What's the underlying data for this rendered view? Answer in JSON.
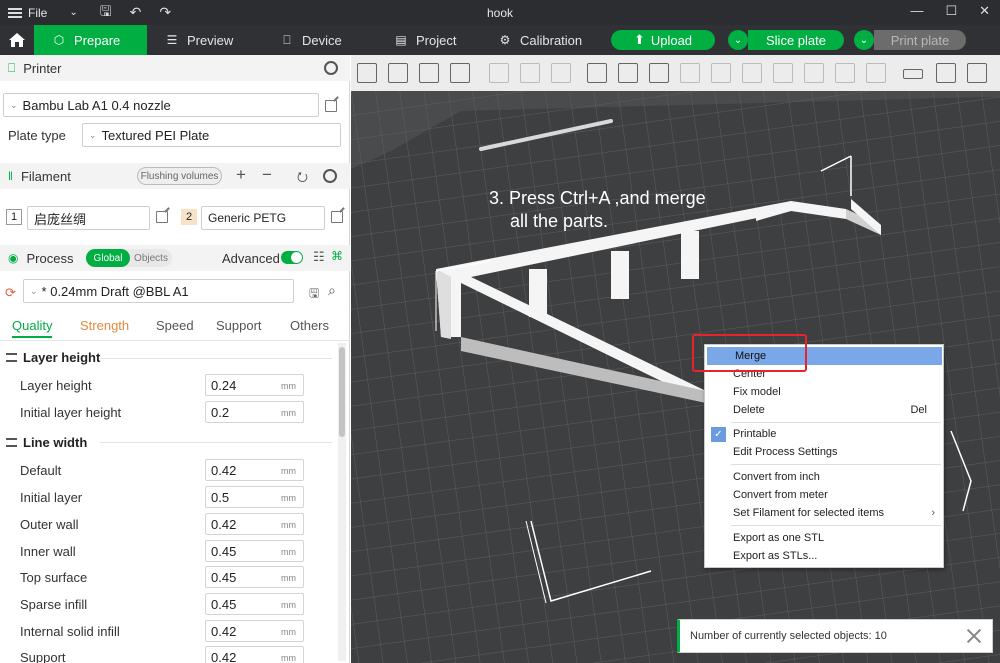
{
  "window": {
    "title": "hook",
    "file_menu": "File"
  },
  "nav": {
    "tabs": [
      "Prepare",
      "Preview",
      "Device",
      "Project",
      "Calibration"
    ],
    "upload": "Upload",
    "slice": "Slice plate",
    "print": "Print plate"
  },
  "printer": {
    "header": "Printer",
    "name": "Bambu Lab A1 0.4 nozzle",
    "plate_label": "Plate type",
    "plate_value": "Textured PEI Plate"
  },
  "filament": {
    "header": "Filament",
    "flushing": "Flushing volumes",
    "add": "+",
    "remove": "−",
    "items": [
      {
        "num": "1",
        "name": "启庞丝绸"
      },
      {
        "num": "2",
        "name": "Generic PETG"
      }
    ]
  },
  "process": {
    "header": "Process",
    "global": "Global",
    "objects": "Objects",
    "advanced": "Advanced",
    "preset": "* 0.24mm Draft @BBL A1",
    "tabs": [
      "Quality",
      "Strength",
      "Speed",
      "Support",
      "Others"
    ],
    "groups": [
      {
        "title": "Layer height"
      },
      {
        "title": "Line width"
      }
    ],
    "layer_params": [
      {
        "label": "Layer height",
        "value": "0.24",
        "unit": "mm"
      },
      {
        "label": "Initial layer height",
        "value": "0.2",
        "unit": "mm"
      }
    ],
    "width_params": [
      {
        "label": "Default",
        "value": "0.42",
        "unit": "mm"
      },
      {
        "label": "Initial layer",
        "value": "0.5",
        "unit": "mm"
      },
      {
        "label": "Outer wall",
        "value": "0.42",
        "unit": "mm"
      },
      {
        "label": "Inner wall",
        "value": "0.45",
        "unit": "mm"
      },
      {
        "label": "Top surface",
        "value": "0.45",
        "unit": "mm"
      },
      {
        "label": "Sparse infill",
        "value": "0.45",
        "unit": "mm"
      },
      {
        "label": "Internal solid infill",
        "value": "0.42",
        "unit": "mm"
      },
      {
        "label": "Support",
        "value": "0.42",
        "unit": "mm"
      }
    ]
  },
  "annotation": {
    "line1": "3. Press Ctrl+A ,and merge",
    "line2": "all the parts."
  },
  "context_menu": {
    "merge": "Merge",
    "center": "Center",
    "fix": "Fix model",
    "delete": "Delete",
    "delete_shortcut": "Del",
    "printable": "Printable",
    "edit_process": "Edit Process Settings",
    "convert_inch": "Convert from inch",
    "convert_meter": "Convert from meter",
    "set_filament": "Set Filament for selected items",
    "export_one": "Export as one STL",
    "export_many": "Export as STLs..."
  },
  "notification": {
    "text": "Number of currently selected objects: 10"
  },
  "colors": {
    "accent": "#00ae42",
    "highlight": "#e8232c",
    "titlebar": "#2b2d30"
  }
}
